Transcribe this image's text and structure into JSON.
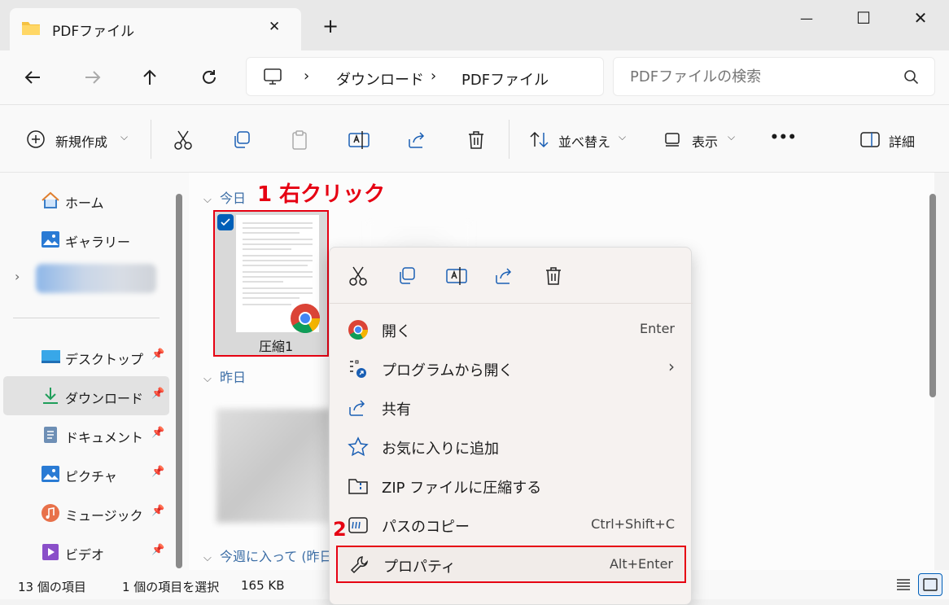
{
  "tab": {
    "title": "PDFファイル",
    "close": "✕",
    "new": "+"
  },
  "window": {
    "minimize": "—",
    "maximize": "☐",
    "close": "✕"
  },
  "address": {
    "segments": [
      "ダウンロード",
      "PDFファイル"
    ],
    "separator": "›"
  },
  "search": {
    "placeholder": "PDFファイルの検索"
  },
  "toolbar": {
    "new_label": "新規作成",
    "sort_label": "並べ替え",
    "view_label": "表示",
    "more_label": "•••",
    "details_label": "詳細"
  },
  "sidebar": {
    "items": [
      {
        "label": "ホーム"
      },
      {
        "label": "ギャラリー"
      },
      {
        "label": "デスクトップ"
      },
      {
        "label": "ダウンロード"
      },
      {
        "label": "ドキュメント"
      },
      {
        "label": "ピクチャ"
      },
      {
        "label": "ミュージック"
      },
      {
        "label": "ビデオ"
      }
    ]
  },
  "main": {
    "groups": [
      "今日",
      "昨日",
      "今週に入って (昨日"
    ],
    "file_name": "圧縮1"
  },
  "annotations": {
    "step1": "1 右クリック",
    "step2": "2"
  },
  "context_menu": {
    "items": [
      {
        "label": "開く",
        "key": "Enter"
      },
      {
        "label": "プログラムから開く",
        "key": "›"
      },
      {
        "label": "共有",
        "key": ""
      },
      {
        "label": "お気に入りに追加",
        "key": ""
      },
      {
        "label": "ZIP ファイルに圧縮する",
        "key": ""
      },
      {
        "label": "パスのコピー",
        "key": "Ctrl+Shift+C"
      },
      {
        "label": "プロパティ",
        "key": "Alt+Enter"
      }
    ]
  },
  "status": {
    "count": "13 個の項目",
    "selected": "1 個の項目を選択",
    "size": "165 KB"
  },
  "colors": {
    "accent": "#005fb8",
    "annotation_red": "#e60012",
    "folder": "#f5c242"
  }
}
